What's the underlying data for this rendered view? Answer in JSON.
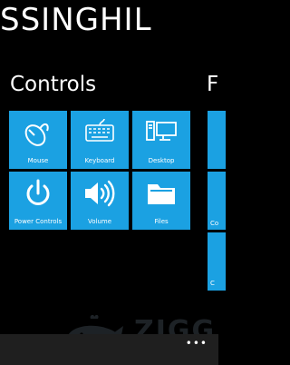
{
  "app": {
    "title": "SSINGHIL"
  },
  "sections": {
    "controls_title": "Controls",
    "next_title": "F"
  },
  "tiles": [
    {
      "label": "Mouse",
      "icon": "mouse-icon"
    },
    {
      "label": "Keyboard",
      "icon": "keyboard-icon"
    },
    {
      "label": "Desktop",
      "icon": "desktop-icon"
    },
    {
      "label": "Power Controls",
      "icon": "power-icon"
    },
    {
      "label": "Volume",
      "icon": "volume-icon"
    },
    {
      "label": "Files",
      "icon": "folder-icon"
    }
  ],
  "peek_labels": [
    "Co",
    "C"
  ],
  "watermark": {
    "text": "ZIGG",
    "icon": "whale-logo"
  },
  "appbar": {
    "more": "•••"
  },
  "colors": {
    "accent": "#1ba1e2",
    "background": "#000000",
    "appbar": "#1f1f1f"
  }
}
